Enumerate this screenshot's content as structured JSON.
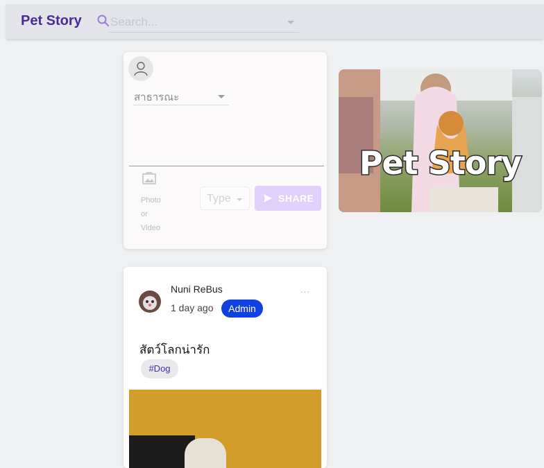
{
  "header": {
    "brand": "Pet Story",
    "search_placeholder": "Search..."
  },
  "composer": {
    "privacy_selected": "สาธารณะ",
    "media_label": "Photo or Video",
    "type_placeholder": "Type",
    "share_label": "SHARE"
  },
  "banner": {
    "logo_text": "Pet Story"
  },
  "post": {
    "author": "Nuni ReBus",
    "time": "1 day ago",
    "role_badge": "Admin",
    "text": "สัตว์โลกน่ารัก",
    "tag": "#Dog",
    "more_label": "..."
  },
  "colors": {
    "brand": "#4b2a97",
    "share_button": "#e0d0fb",
    "admin_badge": "#0f41e0",
    "tag_text": "#4b2fa5"
  },
  "icons": [
    "search-icon",
    "user-icon",
    "image-icon",
    "send-icon",
    "more-horizontal-icon"
  ]
}
